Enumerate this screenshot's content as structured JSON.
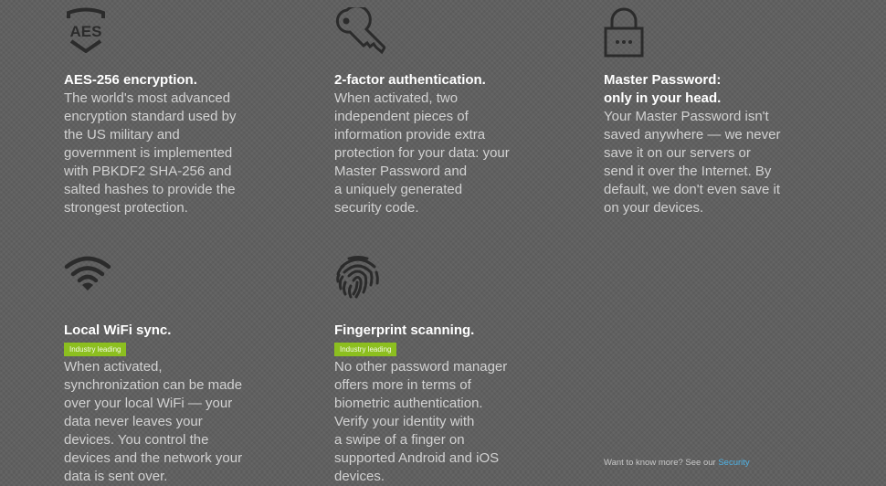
{
  "features": [
    {
      "id": "aes",
      "icon": "aes-shield-icon",
      "title_lines": [
        "AES-256 encryption."
      ],
      "badge": null,
      "description": "The world's most advanced\nencryption standard used by\nthe US military and\ngovernment is implemented\nwith PBKDF2 SHA-256 and\nsalted hashes to provide the\nstrongest protection."
    },
    {
      "id": "2fa",
      "icon": "key-icon",
      "title_lines": [
        "2-factor authentication."
      ],
      "badge": null,
      "description": "When activated, two\nindependent pieces of\ninformation provide extra\nprotection for your data: your\nMaster Password and\na uniquely generated\nsecurity code."
    },
    {
      "id": "master",
      "icon": "padlock-icon",
      "title_lines": [
        "Master Password:",
        "only in your head."
      ],
      "badge": null,
      "description": "Your Master Password isn't\nsaved anywhere — we never\nsave it on our servers or\nsend it over the Internet. By\ndefault, we don't even save it\non your devices."
    },
    {
      "id": "wifi",
      "icon": "wifi-icon",
      "title_lines": [
        "Local WiFi sync."
      ],
      "badge": "Industry leading",
      "description": "When activated,\nsynchronization can be made\nover your local WiFi — your\ndata never leaves your\ndevices. You control the\ndevices and the network your\ndata is sent over."
    },
    {
      "id": "finger",
      "icon": "fingerprint-icon",
      "title_lines": [
        "Fingerprint scanning."
      ],
      "badge": "Industry leading",
      "description": "No other password manager\noffers more in terms of\nbiometric authentication.\nVerify your identity with\na swipe of a finger on\nsupported Android and iOS\ndevices."
    }
  ],
  "footer": {
    "text": "Want to know more? See our ",
    "link_label": "Security"
  },
  "colors": {
    "background": "#5f5f5f",
    "badge": "#8cbf1f",
    "link": "#4fb3e6"
  }
}
